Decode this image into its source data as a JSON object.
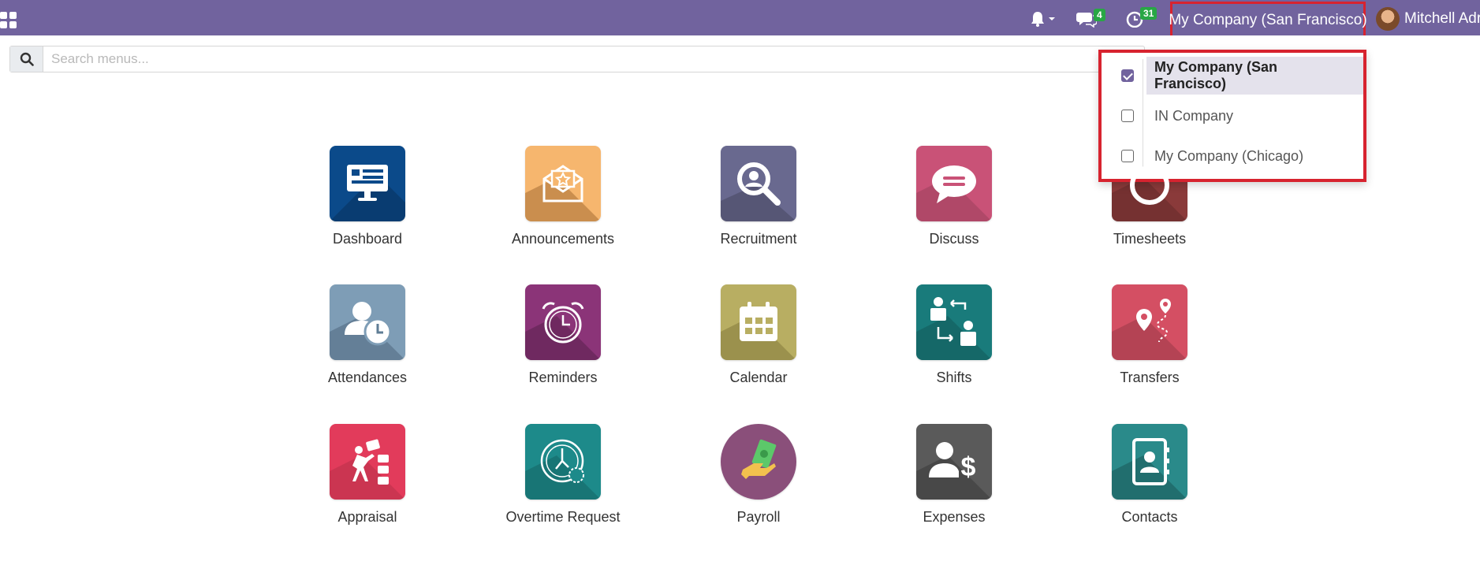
{
  "topbar": {
    "bg_color": "#71639e",
    "apps_icon": "grid-icon",
    "activity_badge": "4",
    "clock_badge": "31",
    "current_company": "My Company (San Francisco)",
    "user_name": "Mitchell Adr"
  },
  "search": {
    "placeholder": "Search menus..."
  },
  "apps": [
    {
      "label": "Dashboard",
      "icon": "monitor-icon",
      "color": "#0b4a8a"
    },
    {
      "label": "Announcements",
      "icon": "envelope-star-icon",
      "color": "#f6b66e"
    },
    {
      "label": "Recruitment",
      "icon": "magnifier-icon",
      "color": "#69698f"
    },
    {
      "label": "Discuss",
      "icon": "chat-bubble-icon",
      "color": "#c95277"
    },
    {
      "label": "Timesheets",
      "icon": "timer-icon",
      "color": "#8a3a3a"
    },
    {
      "label": "Attendances",
      "icon": "person-clock-icon",
      "color": "#7e9db6"
    },
    {
      "label": "Reminders",
      "icon": "alarm-clock-icon",
      "color": "#8b3478"
    },
    {
      "label": "Calendar",
      "icon": "calendar-icon",
      "color": "#b8ae62"
    },
    {
      "label": "Shifts",
      "icon": "swap-people-icon",
      "color": "#197b7b"
    },
    {
      "label": "Transfers",
      "icon": "map-pin-icon",
      "color": "#d44f63"
    },
    {
      "label": "Appraisal",
      "icon": "rating-person-icon",
      "color": "#e23b5b"
    },
    {
      "label": "Overtime Request",
      "icon": "watch-icon",
      "color": "#1d8a8a"
    },
    {
      "label": "Payroll",
      "icon": "money-hand-icon",
      "color": "#8a4f7a"
    },
    {
      "label": "Expenses",
      "icon": "person-dollar-icon",
      "color": "#5a5a5a"
    },
    {
      "label": "Contacts",
      "icon": "address-book-icon",
      "color": "#2a8a8a"
    }
  ],
  "company_dropdown": {
    "items": [
      {
        "label": "My Company (San Francisco)",
        "checked": true
      },
      {
        "label": "IN Company",
        "checked": false
      },
      {
        "label": "My Company (Chicago)",
        "checked": false
      }
    ]
  }
}
